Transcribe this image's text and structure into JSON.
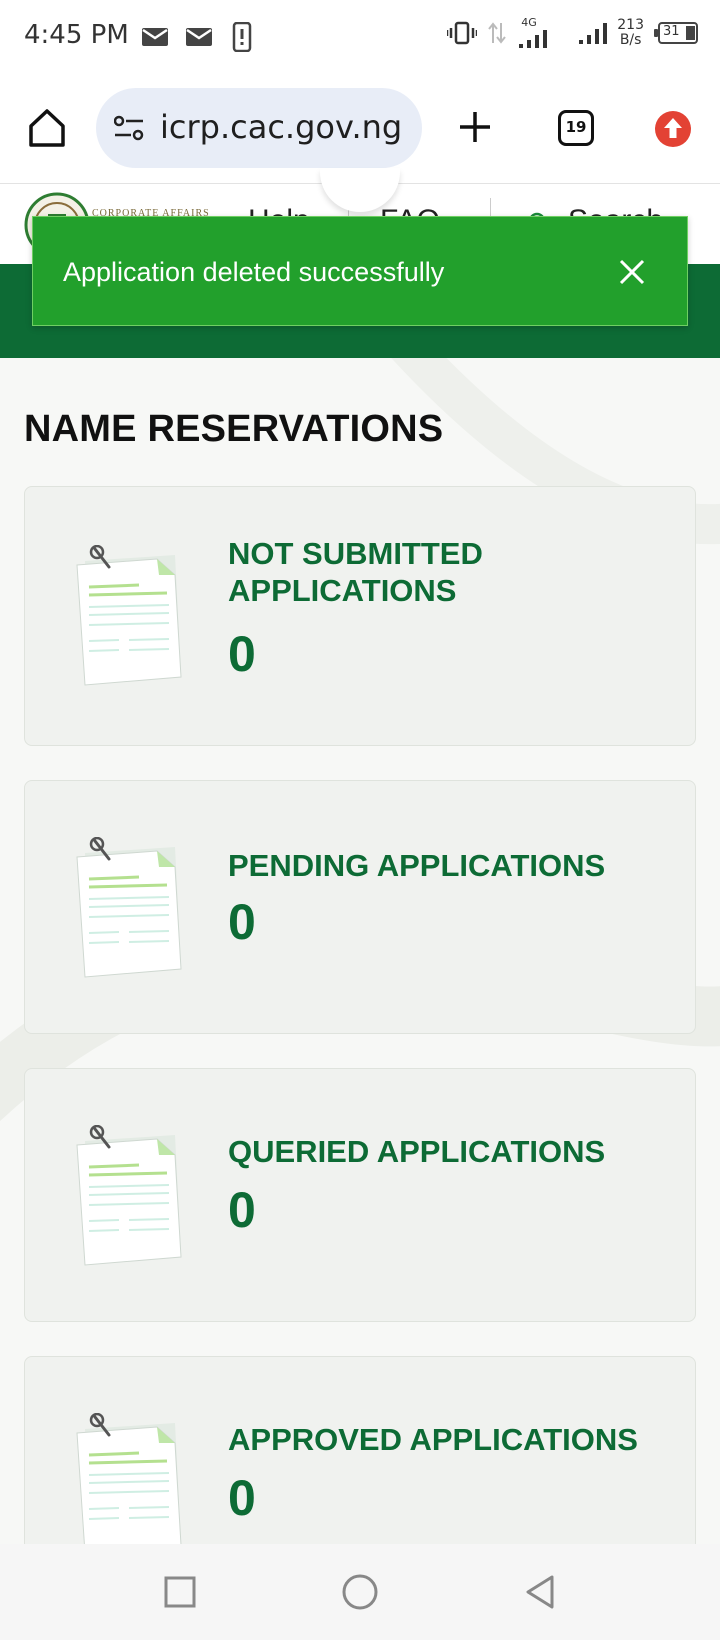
{
  "status_bar": {
    "time": "4:45 PM",
    "speed_value": "213",
    "speed_unit": "B/s",
    "network": "4G",
    "battery": "31"
  },
  "browser": {
    "url": "icrp.cac.gov.ng",
    "tab_count": "19"
  },
  "site_header": {
    "logo_text": "CORPORATE AFFAIRS",
    "nav_help": "Help",
    "nav_faq": "FAQ",
    "nav_search": "Search"
  },
  "toast": {
    "message": "Application deleted successfully"
  },
  "page": {
    "title": "NAME RESERVATIONS",
    "cards": [
      {
        "title": "NOT SUBMITTED APPLICATIONS",
        "count": "0"
      },
      {
        "title": "PENDING APPLICATIONS",
        "count": "0"
      },
      {
        "title": "QUERIED APPLICATIONS",
        "count": "0"
      },
      {
        "title": "APPROVED APPLICATIONS",
        "count": "0"
      }
    ]
  },
  "colors": {
    "brand_green": "#0d6b35",
    "toast_green": "#22a02c",
    "update_red": "#e34234"
  }
}
